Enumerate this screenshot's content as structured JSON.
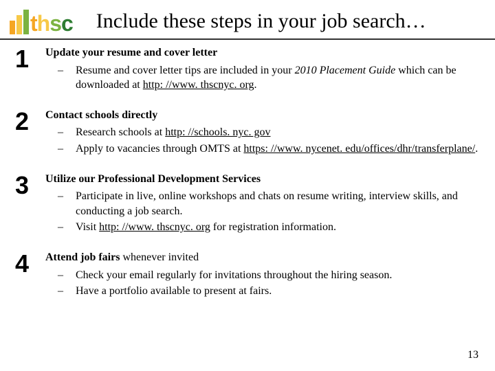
{
  "logo": {
    "letters": {
      "t": "t",
      "h": "h",
      "s": "s",
      "c": "c"
    }
  },
  "title": "Include these steps in your job search…",
  "steps": [
    {
      "num": "1",
      "heading": "Update your resume and cover letter",
      "heading_suffix": "",
      "bullets": [
        {
          "pre": "Resume and cover letter tips are included in your ",
          "italic": "2010 Placement Guide ",
          "mid": "which can be downloaded at ",
          "link": "http: //www. thscnyc. org",
          "post": ". "
        }
      ]
    },
    {
      "num": "2",
      "heading": "Contact schools directly",
      "heading_suffix": "",
      "bullets": [
        {
          "pre": "Research schools at ",
          "link": "http: //schools. nyc. gov",
          "post": ""
        },
        {
          "pre": "Apply to vacancies through OMTS at ",
          "link": "https: //www. nycenet. edu/offices/dhr/transferplane/",
          "post": ". "
        }
      ]
    },
    {
      "num": "3",
      "heading": "Utilize our Professional Development Services",
      "heading_suffix": "",
      "bullets": [
        {
          "pre": "Participate in live, online workshops and chats on resume writing, interview skills, and conducting a job search.",
          "post": ""
        },
        {
          "pre": "Visit ",
          "link": "http: //www. thscnyc. org",
          "post": "  for registration information."
        }
      ]
    },
    {
      "num": "4",
      "heading": "Attend job fairs",
      "heading_suffix": " whenever invited",
      "bullets": [
        {
          "pre": "Check your email regularly for invitations throughout the hiring season.",
          "post": ""
        },
        {
          "pre": "Have a portfolio available to present at fairs.",
          "post": ""
        }
      ]
    }
  ],
  "page_number": "13"
}
